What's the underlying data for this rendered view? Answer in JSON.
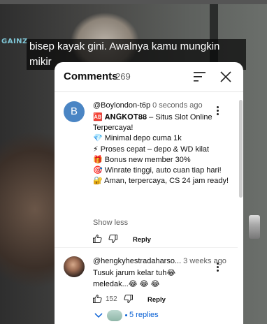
{
  "video": {
    "channel_tag": "GAINZ",
    "caption_line1": "bisep kayak gini. Awalnya kamu mungkin",
    "caption_line2": "mikir"
  },
  "comments_panel": {
    "title": "Comments",
    "count": "269"
  },
  "comment1": {
    "avatar_letter": "B",
    "author": "@Boylondon-t6p",
    "time": "0 seconds ago",
    "lines": [
      "🆎 𝐀𝐍𝐆𝐊𝐎𝐓𝟖𝟖 – Situs Slot Online Terpercaya!",
      "💎 Minimal depo cuma 1k",
      "⚡ Proses cepat – depo & WD kilat",
      "🎁 Bonus new member 30%",
      "🎯 Winrate tinggi, auto cuan tiap hari!",
      "🔐 Aman, terpercaya, CS 24 jam ready!"
    ],
    "show_less": "Show less",
    "reply_label": "Reply"
  },
  "comment2": {
    "author": "@hengkyhestradaharso...",
    "time": "3 weeks ago",
    "lines": [
      "Tusuk jarum kelar tuh😂",
      "meledak...😂 😂 😂"
    ],
    "likes": "152",
    "reply_label": "Reply",
    "replies_label": "5 replies"
  },
  "colors": {
    "link_blue": "#065fd4",
    "avatar_blue": "#4a85c4"
  }
}
